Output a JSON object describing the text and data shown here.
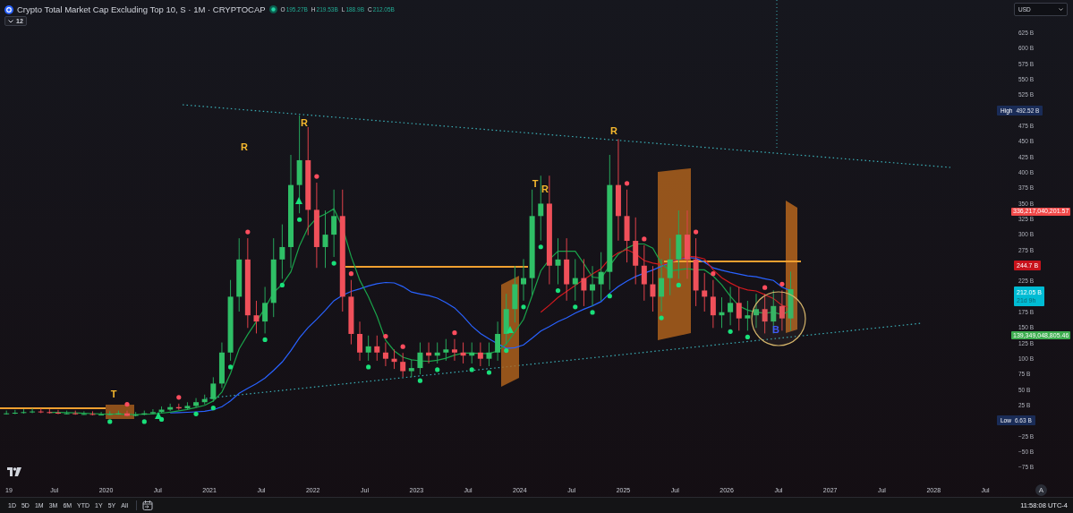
{
  "header": {
    "title": "Crypto Total Market Cap Excluding Top 10, S · 1M · CRYPTOCAP",
    "ohlc": [
      {
        "label": "O",
        "value": "195.27B"
      },
      {
        "label": "H",
        "value": "219.53B"
      },
      {
        "label": "L",
        "value": "188.9B"
      },
      {
        "label": "C",
        "value": "212.05B"
      }
    ]
  },
  "indicators_toggle": {
    "count": "12",
    "expanded": false
  },
  "currency": "USD",
  "price_axis": [
    {
      "kind": "tick",
      "label": "625 B"
    },
    {
      "kind": "tick",
      "label": "600 B"
    },
    {
      "kind": "tick",
      "label": "575 B"
    },
    {
      "kind": "tick",
      "label": "550 B"
    },
    {
      "kind": "tick",
      "label": "525 B"
    },
    {
      "kind": "extreme",
      "label": "High",
      "value": "492.52 B"
    },
    {
      "kind": "tick",
      "label": "475 B"
    },
    {
      "kind": "tick",
      "label": "450 B"
    },
    {
      "kind": "tick",
      "label": "425 B"
    },
    {
      "kind": "tick",
      "label": "400 B"
    },
    {
      "kind": "tick",
      "label": "375 B"
    },
    {
      "kind": "tick",
      "label": "350 B"
    },
    {
      "kind": "tick",
      "label": "325 B"
    },
    {
      "kind": "tick",
      "label": "300 B"
    },
    {
      "kind": "tick",
      "label": "275 B"
    },
    {
      "kind": "price",
      "value": "244.7 B",
      "color": "#c8131c"
    },
    {
      "kind": "tick",
      "label": "225 B"
    },
    {
      "kind": "countdown",
      "value": "212.05 B",
      "countdown": "21d 9h",
      "color": "#00bcd4"
    },
    {
      "kind": "tick",
      "label": "175 B"
    },
    {
      "kind": "tick",
      "label": "150 B"
    },
    {
      "kind": "tick",
      "label": "125 B"
    },
    {
      "kind": "tick",
      "label": "100 B"
    },
    {
      "kind": "tick",
      "label": "75 B"
    },
    {
      "kind": "tick",
      "label": "50 B"
    },
    {
      "kind": "tick",
      "label": "25 B"
    },
    {
      "kind": "extreme",
      "label": "Low",
      "value": "6.63 B"
    },
    {
      "kind": "tick",
      "label": "−25 B"
    },
    {
      "kind": "tick",
      "label": "−50 B"
    },
    {
      "kind": "tick",
      "label": "−75 B"
    }
  ],
  "floating_badges": [
    {
      "value": "336,217,040,201.57",
      "color": "#f24a4a"
    },
    {
      "value": "139,349,048,805.46",
      "color": "#3dad4f"
    }
  ],
  "time_axis": [
    "19",
    "Jul",
    "2020",
    "Jul",
    "2021",
    "Jul",
    "2022",
    "Jul",
    "2023",
    "Jul",
    "2024",
    "Jul",
    "2025",
    "Jul",
    "2026",
    "Jul",
    "2027",
    "Jul",
    "2028",
    "Jul"
  ],
  "chart_markers": [
    {
      "text": "T",
      "color": "#f5b82e"
    },
    {
      "text": "R",
      "color": "#f5b82e"
    },
    {
      "text": "R",
      "color": "#f5b82e"
    },
    {
      "text": "T",
      "color": "#f5b82e"
    },
    {
      "text": "R",
      "color": "#f5b82e"
    },
    {
      "text": "R",
      "color": "#f5b82e"
    },
    {
      "text": "B",
      "color": "#3f5bf5"
    }
  ],
  "range_buttons": [
    {
      "label": "1D",
      "selected": false
    },
    {
      "label": "5D",
      "selected": false
    },
    {
      "label": "1M",
      "selected": false
    },
    {
      "label": "3M",
      "selected": false
    },
    {
      "label": "6M",
      "selected": false
    },
    {
      "label": "YTD",
      "selected": false
    },
    {
      "label": "1Y",
      "selected": false
    },
    {
      "label": "5Y",
      "selected": false
    },
    {
      "label": "All",
      "selected": false
    }
  ],
  "clock": "11:58:08 UTC-4",
  "auto_scale": "A"
}
